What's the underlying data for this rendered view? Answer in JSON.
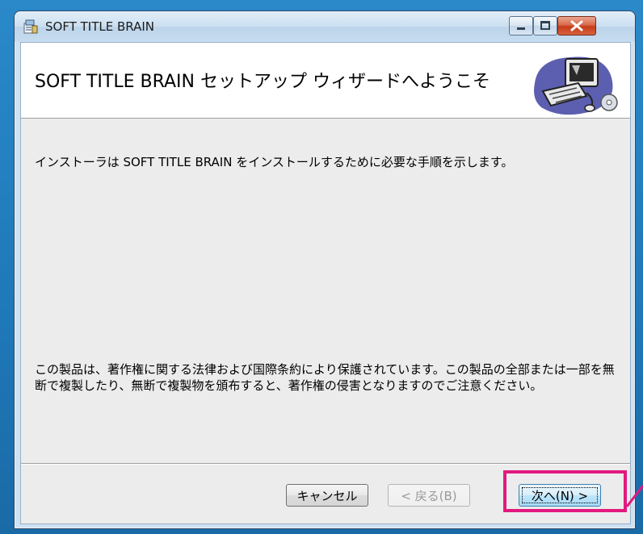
{
  "window": {
    "title": "SOFT TITLE BRAIN"
  },
  "banner": {
    "title": "SOFT TITLE BRAIN セットアップ ウィザードへようこそ"
  },
  "main": {
    "intro": "インストーラは SOFT TITLE BRAIN をインストールするために必要な手順を示します。",
    "copyright": "この製品は、著作権に関する法律および国際条約により保護されています。この製品の全部または一部を無断で複製したり、無断で複製物を頒布すると、著作権の侵害となりますのでご注意ください。"
  },
  "buttons": {
    "cancel": "キャンセル",
    "back": "< 戻る(B)",
    "next": "次へ(N) >"
  },
  "colors": {
    "highlight": "#e2197f",
    "desktop": "#1f78b8"
  },
  "icons": [
    "installer-app-icon",
    "minimize-icon",
    "maximize-icon",
    "close-icon",
    "computer-setup-icon"
  ]
}
